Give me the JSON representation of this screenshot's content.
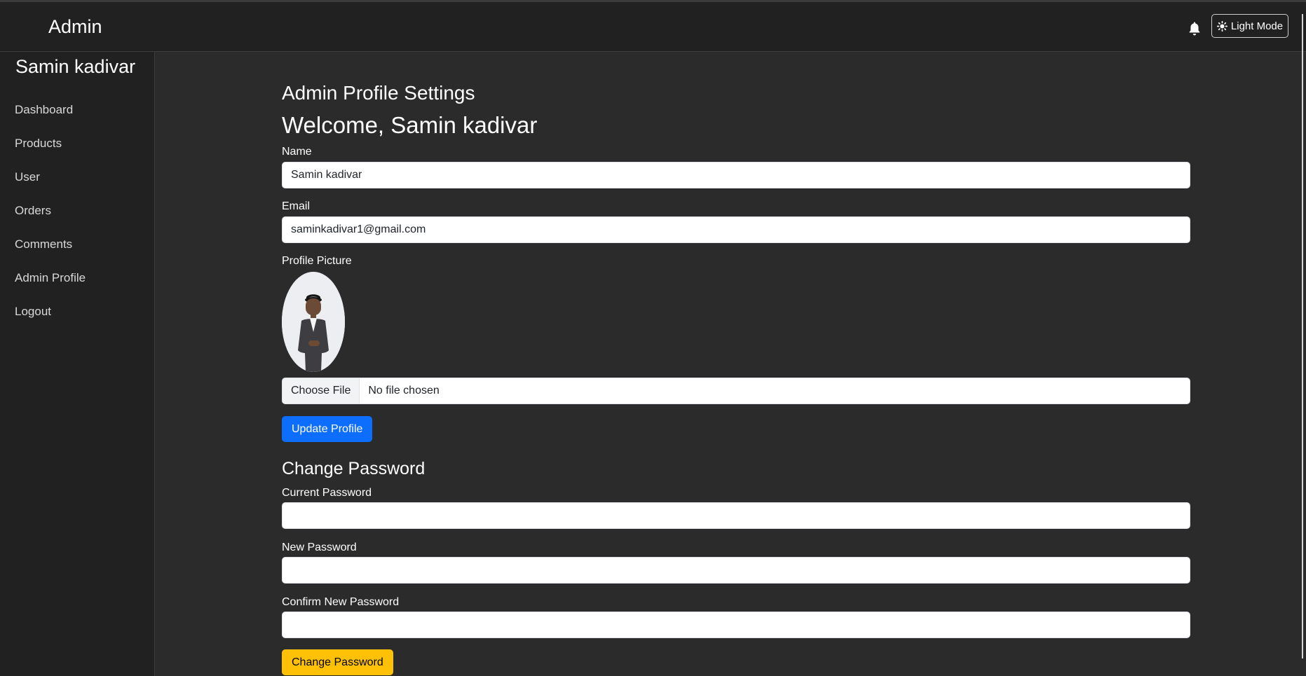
{
  "header": {
    "brand": "Admin",
    "theme_toggle_label": "Light Mode"
  },
  "sidebar": {
    "user_name": "Samin kadivar",
    "items": [
      {
        "label": "Dashboard"
      },
      {
        "label": "Products"
      },
      {
        "label": "User"
      },
      {
        "label": "Orders"
      },
      {
        "label": "Comments"
      },
      {
        "label": "Admin Profile"
      },
      {
        "label": "Logout"
      }
    ]
  },
  "profile": {
    "title": "Admin Profile Settings",
    "welcome": "Welcome, Samin kadivar",
    "name_label": "Name",
    "name_value": "Samin kadivar",
    "email_label": "Email",
    "email_value": "saminkadivar1@gmail.com",
    "picture_label": "Profile Picture",
    "choose_file_label": "Choose File",
    "file_status": "No file chosen",
    "update_button": "Update Profile"
  },
  "password": {
    "title": "Change Password",
    "current_label": "Current Password",
    "new_label": "New Password",
    "confirm_label": "Confirm New Password",
    "submit_button": "Change Password"
  }
}
